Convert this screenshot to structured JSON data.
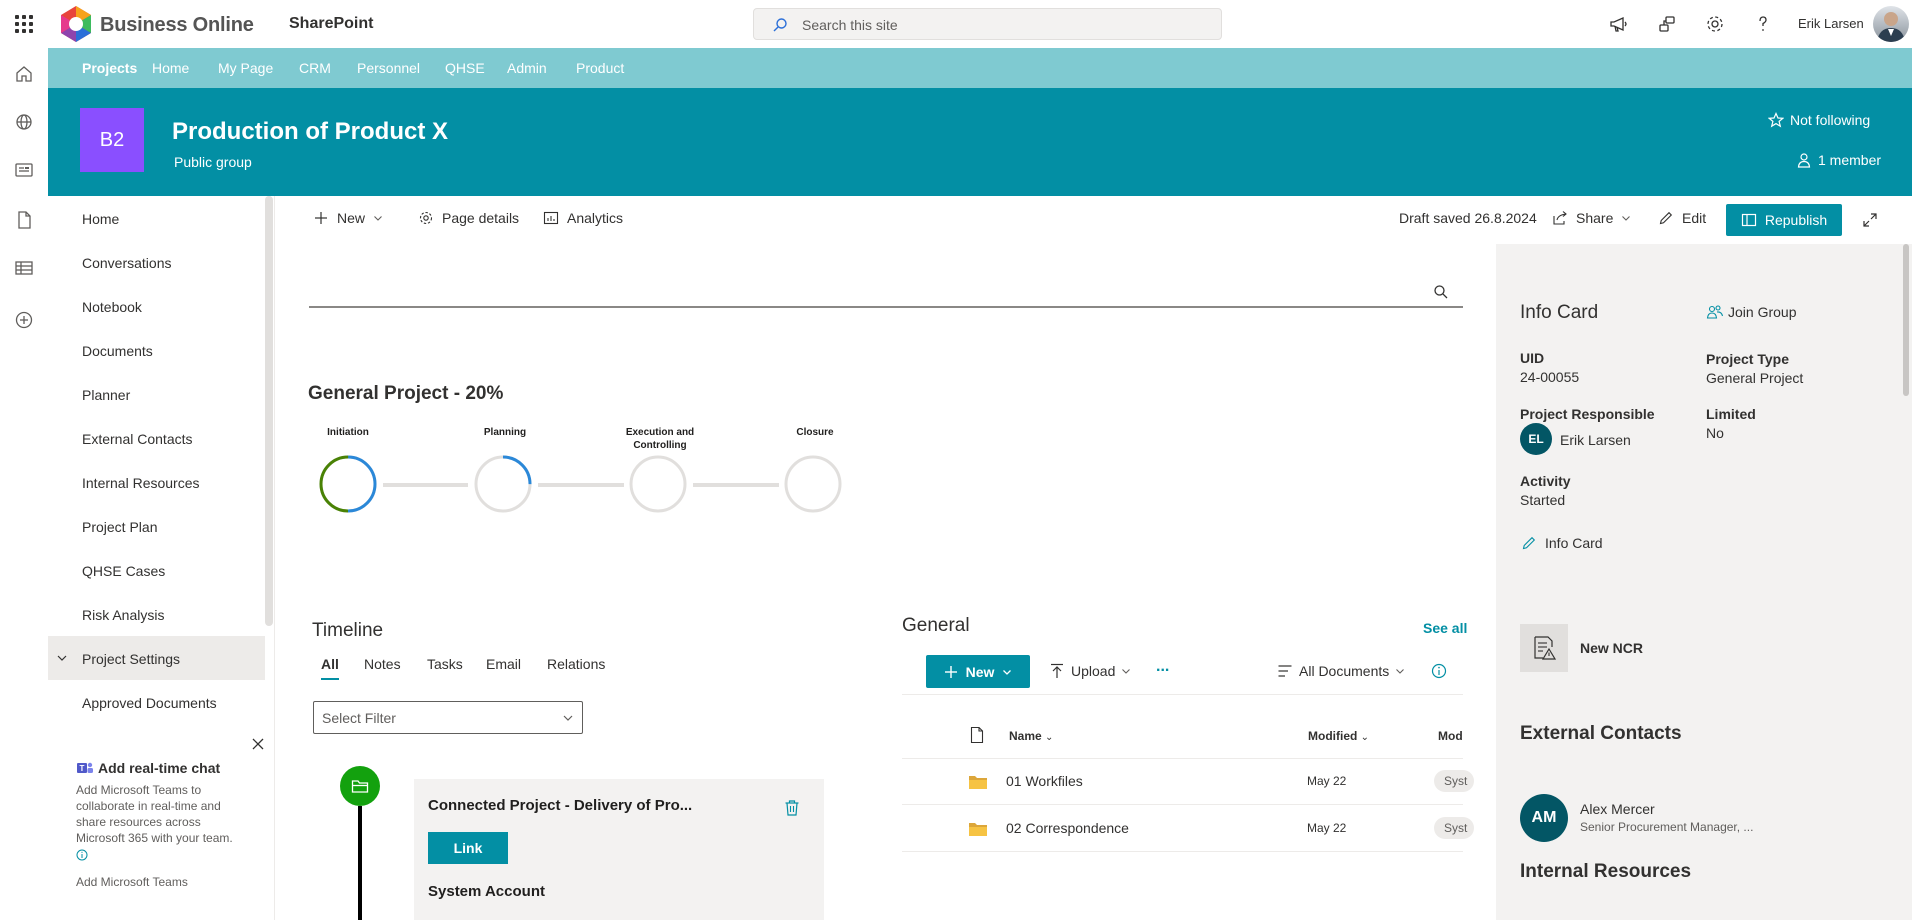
{
  "suite": {
    "brand": "Business Online",
    "app": "SharePoint",
    "search_placeholder": "Search this site",
    "user": "Erik Larsen"
  },
  "hubnav": [
    "Projects",
    "Home",
    "My Page",
    "CRM",
    "Personnel",
    "QHSE",
    "Admin",
    "Product"
  ],
  "site": {
    "logo": "B2",
    "title": "Production of Product X",
    "subtitle": "Public group",
    "follow": "Not following",
    "members": "1 member"
  },
  "leftnav": {
    "items": [
      "Home",
      "Conversations",
      "Notebook",
      "Documents",
      "Planner",
      "External Contacts",
      "Internal Resources",
      "Project Plan",
      "QHSE Cases",
      "Risk Analysis",
      "Project Settings",
      "Approved Documents"
    ],
    "selected": "Project Settings"
  },
  "teams_promo": {
    "title": "Add real-time chat",
    "description": "Add Microsoft Teams to collaborate in real-time and share resources across Microsoft 365 with your team.",
    "link": "Add Microsoft Teams"
  },
  "commandbar": {
    "new": "New",
    "page_details": "Page details",
    "analytics": "Analytics",
    "draft_status": "Draft saved 26.8.2024",
    "share": "Share",
    "edit": "Edit",
    "republish": "Republish"
  },
  "project": {
    "title": "General Project  - 20%",
    "progress": 0.2,
    "phases": [
      {
        "label": "Initiation",
        "progress": 0.5,
        "color": "#498205"
      },
      {
        "label": "Planning",
        "progress": 0.25,
        "color": "#2b88d8"
      },
      {
        "label": "Execution and Controlling",
        "progress": 0,
        "color": "#e1dfdd"
      },
      {
        "label": "Closure",
        "progress": 0,
        "color": "#e1dfdd"
      }
    ]
  },
  "timeline": {
    "title": "Timeline",
    "tabs": [
      "All",
      "Notes",
      "Tasks",
      "Email",
      "Relations"
    ],
    "active_tab": "All",
    "filter_placeholder": "Select Filter",
    "entry": {
      "title": "Connected Project - Delivery of Pro...",
      "link_label": "Link",
      "author": "System Account"
    }
  },
  "documents": {
    "title": "General",
    "see_all": "See all",
    "new": "New",
    "upload": "Upload",
    "more": "...",
    "view": "All Documents",
    "columns": [
      "Name",
      "Modified",
      "Mod"
    ],
    "rows": [
      {
        "name": "01 Workfiles",
        "modified": "May 22",
        "modified_by": "Syst"
      },
      {
        "name": "02 Correspondence",
        "modified": "May 22",
        "modified_by": "Syst"
      }
    ]
  },
  "info_card": {
    "title": "Info Card",
    "join": "Join Group",
    "uid_label": "UID",
    "uid": "24-00055",
    "type_label": "Project Type",
    "type": "General Project",
    "responsible_label": "Project Responsible",
    "responsible_initials": "EL",
    "responsible": "Erik Larsen",
    "limited_label": "Limited",
    "limited": "No",
    "activity_label": "Activity",
    "activity": "Started",
    "edit_link": "Info Card",
    "new_ncr": "New NCR",
    "external_contacts_title": "External Contacts",
    "contact_initials": "AM",
    "contact_name": "Alex Mercer",
    "contact_role": "Senior Procurement Manager, ...",
    "internal_resources_title": "Internal Resources"
  }
}
